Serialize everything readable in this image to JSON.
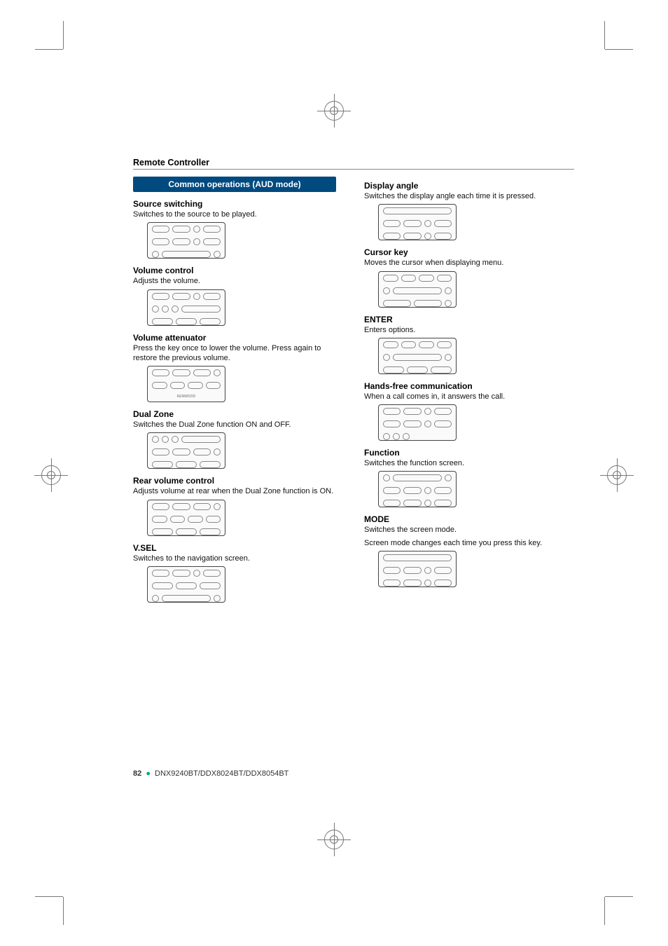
{
  "header": {
    "section": "Remote Controller"
  },
  "banner": "Common operations (AUD mode)",
  "left": [
    {
      "title": "Source switching",
      "text": "Switches to the source to be played."
    },
    {
      "title": "Volume control",
      "text": "Adjusts the volume."
    },
    {
      "title": "Volume attenuator",
      "text": "Press the key once to lower the volume. Press again to restore the previous volume."
    },
    {
      "title": "Dual Zone",
      "text": "Switches the Dual Zone function ON and OFF."
    },
    {
      "title": "Rear volume control",
      "text": "Adjusts volume at rear when the Dual Zone function is ON."
    },
    {
      "title": "V.SEL",
      "text": "Switches to the navigation screen."
    }
  ],
  "right": [
    {
      "title": "Display angle",
      "text": "Switches the display angle each time it is pressed."
    },
    {
      "title": "Cursor key",
      "text": "Moves the cursor when displaying menu."
    },
    {
      "title": "ENTER",
      "text": "Enters options."
    },
    {
      "title": "Hands-free communication",
      "text": "When a call comes in, it answers the call."
    },
    {
      "title": "Function",
      "text": "Switches the function screen."
    },
    {
      "title": "MODE",
      "text": "Switches the screen mode.",
      "text2": "Screen mode changes each time you press this key."
    }
  ],
  "footer": {
    "page": "82",
    "models": "DNX9240BT/DDX8024BT/DDX8054BT"
  }
}
